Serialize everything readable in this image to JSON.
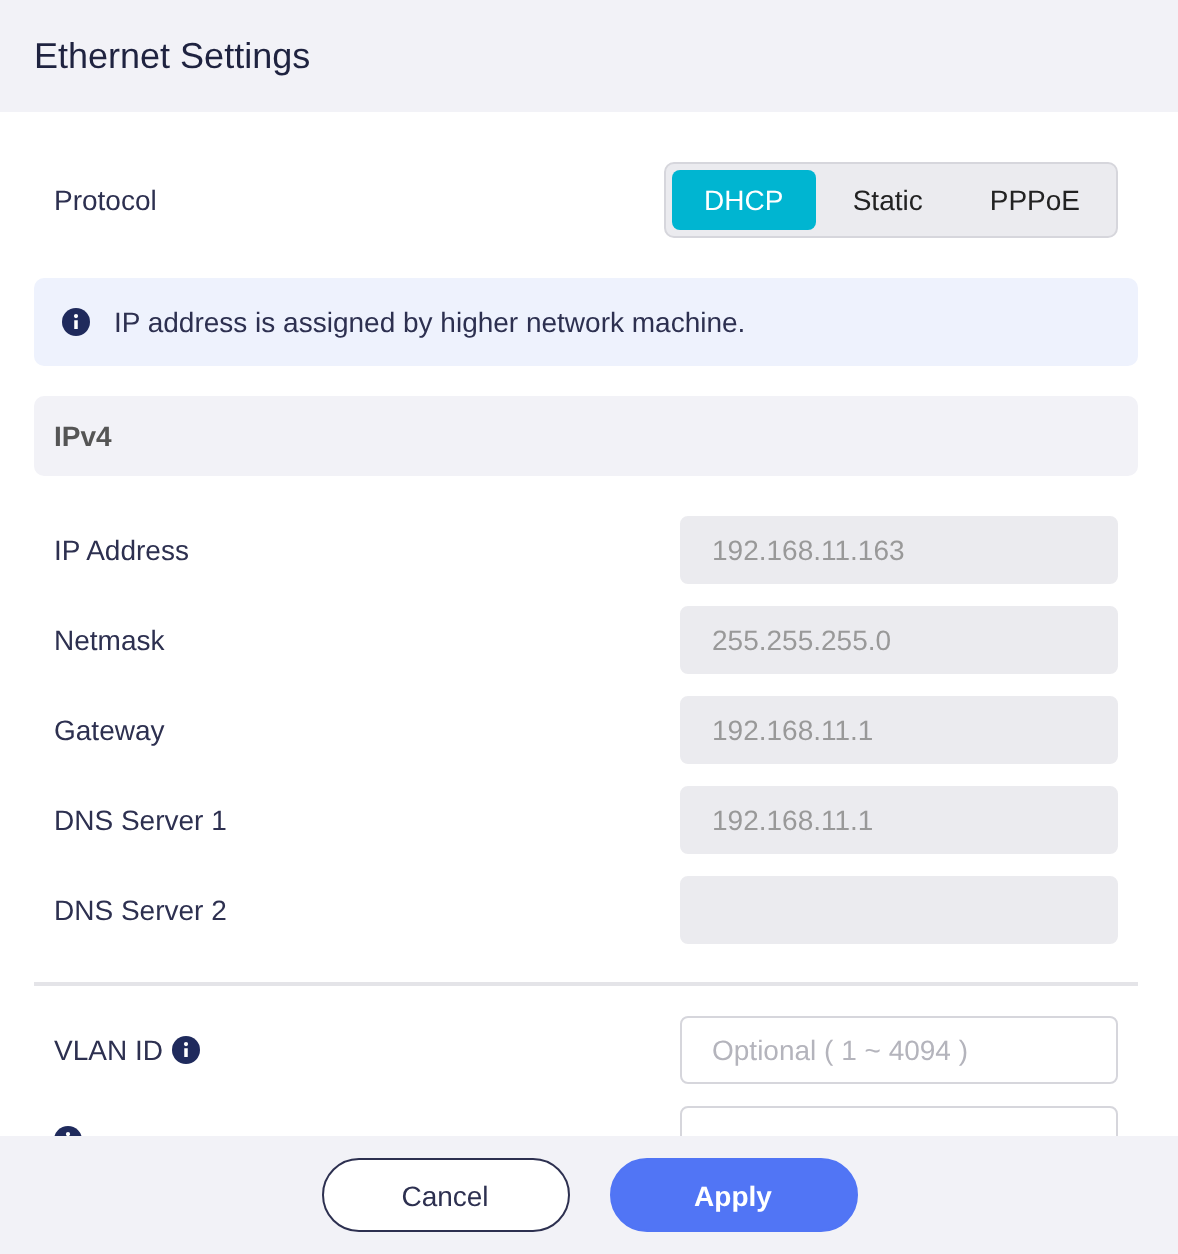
{
  "window": {
    "title": "Ethernet Settings"
  },
  "protocol": {
    "label": "Protocol",
    "options": [
      {
        "label": "DHCP",
        "selected": true
      },
      {
        "label": "Static",
        "selected": false
      },
      {
        "label": "PPPoE",
        "selected": false
      }
    ]
  },
  "notice": {
    "text": "IP address is assigned by higher network machine."
  },
  "section": {
    "title": "IPv4"
  },
  "ipv4_fields": [
    {
      "label": "IP Address",
      "value": "192.168.11.163",
      "disabled": true
    },
    {
      "label": "Netmask",
      "value": "255.255.255.0",
      "disabled": true
    },
    {
      "label": "Gateway",
      "value": "192.168.11.1",
      "disabled": true
    },
    {
      "label": "DNS Server 1",
      "value": "192.168.11.1",
      "disabled": true
    },
    {
      "label": "DNS Server 2",
      "disabled": true
    }
  ],
  "extra_fields": [
    {
      "label": "VLAN ID",
      "placeholder": "Optional ( 1 ~ 4094 )",
      "info": true
    },
    {
      "info": true
    }
  ],
  "buttons": [
    {
      "label": "Cancel",
      "kind": "secondary"
    },
    {
      "label": "Apply",
      "kind": "primary"
    }
  ]
}
